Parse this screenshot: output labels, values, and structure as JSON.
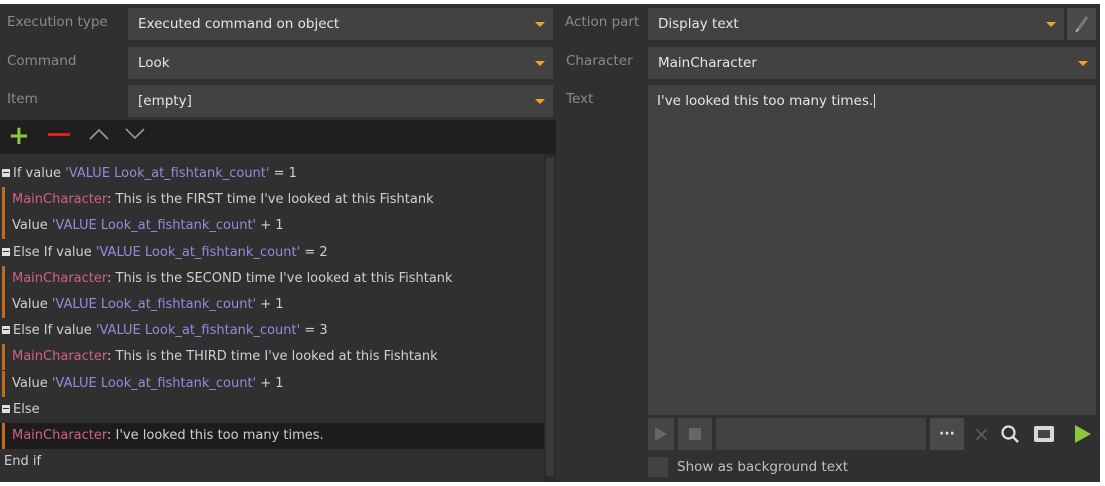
{
  "labels": {
    "execution_type": "Execution type",
    "command": "Command",
    "item": "Item",
    "action_part": "Action part",
    "character": "Character",
    "text": "Text"
  },
  "fields": {
    "execution_type": "Executed command on object",
    "command": "Look",
    "item": "[empty]",
    "action_part": "Display text",
    "character": "MainCharacter",
    "text": "I've looked this too many times."
  },
  "toolbar": {
    "add": "+",
    "remove": "—"
  },
  "tree": [
    {
      "kind": "if",
      "prefix": "If value ",
      "var": "'VALUE Look_at_fishtank_count'",
      "suffix": " = 1"
    },
    {
      "kind": "say",
      "char": "MainCharacter",
      "sep": ": ",
      "text": "This is the FIRST time I've looked at this Fishtank"
    },
    {
      "kind": "set",
      "prefix": "Value ",
      "var": "'VALUE Look_at_fishtank_count'",
      "suffix": " + 1"
    },
    {
      "kind": "if",
      "prefix": "Else If value ",
      "var": "'VALUE Look_at_fishtank_count'",
      "suffix": " = 2"
    },
    {
      "kind": "say",
      "char": "MainCharacter",
      "sep": ": ",
      "text": "This is the SECOND time I've looked at this Fishtank"
    },
    {
      "kind": "set",
      "prefix": "Value ",
      "var": "'VALUE Look_at_fishtank_count'",
      "suffix": " + 1"
    },
    {
      "kind": "if",
      "prefix": "Else If value ",
      "var": "'VALUE Look_at_fishtank_count'",
      "suffix": " = 3"
    },
    {
      "kind": "say",
      "char": "MainCharacter",
      "sep": ": ",
      "text": "This is the THIRD time I've looked at this Fishtank"
    },
    {
      "kind": "set",
      "prefix": "Value ",
      "var": "'VALUE Look_at_fishtank_count'",
      "suffix": " + 1"
    },
    {
      "kind": "else",
      "prefix": "Else"
    },
    {
      "kind": "say",
      "char": "MainCharacter",
      "sep": ": ",
      "text": "I've looked this too many times.",
      "selected": true
    },
    {
      "kind": "end",
      "prefix": "End if"
    }
  ],
  "player": {
    "more": "···",
    "clear": "×",
    "show_background": "Show as background text",
    "show_background_checked": false
  },
  "colors": {
    "variable": "#8e8edc",
    "character": "#d45e8c",
    "accent": "#f0a22e",
    "add": "#8dc63f",
    "remove": "#d9231f",
    "play": "#8dc63f"
  }
}
